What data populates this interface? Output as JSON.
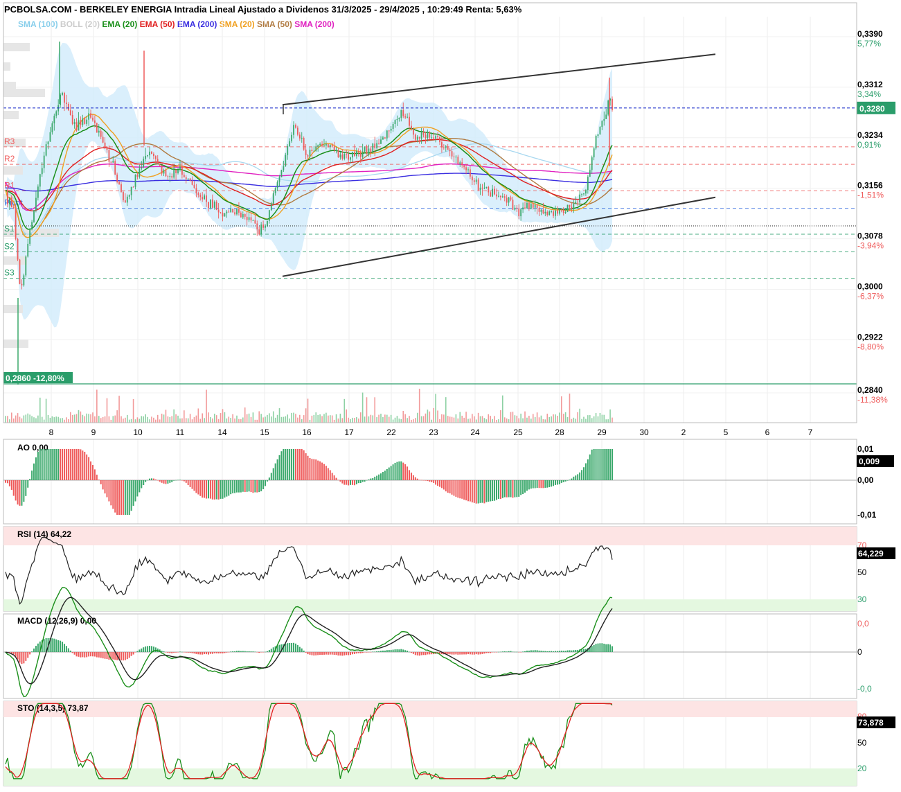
{
  "header": {
    "title": "PCBOLSA.COM - BERKELEY ENERGIA Intradia Lineal Ajustado a Dividenos 31/3/2025 - 29/4/2025 , 10:29:49 Renta: 5,63%"
  },
  "legend": [
    {
      "label": "SMA (100)",
      "color": "#87ceeb"
    },
    {
      "label": "BOLL (20)",
      "color": "#cccccc"
    },
    {
      "label": "EMA (20)",
      "color": "#1a8f1a"
    },
    {
      "label": "EMA (50)",
      "color": "#e02020"
    },
    {
      "label": "EMA (200)",
      "color": "#3a2ee0"
    },
    {
      "label": "SMA (20)",
      "color": "#f0a020"
    },
    {
      "label": "SMA (50)",
      "color": "#b07a40"
    },
    {
      "label": "SMA (200)",
      "color": "#e020c0"
    }
  ],
  "colors": {
    "up": "#3aa86b",
    "down": "#ef5b5b",
    "pivot": "#3a6fe0",
    "support": "#2a9d6a",
    "resistance": "#ef5b5b",
    "boll_fill": "#d3ecfb"
  },
  "chart_data": [
    {
      "type": "line",
      "title": "BERKELEY ENERGIA",
      "x_ticks": [
        "8",
        "9",
        "10",
        "11",
        "14",
        "15",
        "16",
        "17",
        "22",
        "23",
        "24",
        "25",
        "28",
        "29",
        "30",
        "2",
        "5",
        "6",
        "7"
      ],
      "ylim": [
        0.284,
        0.339
      ],
      "y_ticks": [
        {
          "value": "0,3390",
          "pct": "5,77%",
          "pct_color": "#2a9d6a"
        },
        {
          "value": "0,3312",
          "pct": "3,34%",
          "pct_color": "#2a9d6a"
        },
        {
          "value": "0,3234",
          "pct": "0,91%",
          "pct_color": "#2a9d6a"
        },
        {
          "value": "0,3156",
          "pct": "-1,51%",
          "pct_color": "#ef5b5b"
        },
        {
          "value": "0,3078",
          "pct": "-3,94%",
          "pct_color": "#ef5b5b"
        },
        {
          "value": "0,3000",
          "pct": "-6,37%",
          "pct_color": "#ef5b5b"
        },
        {
          "value": "0,2922",
          "pct": "-8,80%",
          "pct_color": "#ef5b5b"
        },
        {
          "value": "0,2840",
          "pct": "-11,38%",
          "pct_color": "#ef5b5b"
        }
      ],
      "last_price": "0,3280",
      "low_marker": "0,2860  -12,80%",
      "levels": [
        {
          "label": "R3",
          "value": 0.322
        },
        {
          "label": "R2",
          "value": 0.3193
        },
        {
          "label": "R1",
          "value": 0.3152
        },
        {
          "label": "Pivot",
          "value": 0.3125
        },
        {
          "label": "S1",
          "value": 0.3085
        },
        {
          "label": "S2",
          "value": 0.3058
        },
        {
          "label": "S3",
          "value": 0.3017
        }
      ],
      "trendlines": [
        {
          "x1": "15",
          "y1": 0.3285,
          "x2": "2",
          "y2": 0.3363
        },
        {
          "x1": "15",
          "y1": 0.302,
          "x2": "2",
          "y2": 0.3142
        }
      ]
    },
    {
      "type": "bar",
      "title": "AO",
      "value_label": "0,00",
      "y_ticks": [
        "0,01",
        "0,00",
        "-0,01"
      ],
      "last_value": "0,009"
    },
    {
      "type": "line",
      "title": "RSI (14)",
      "value_label": "64,22",
      "y_ticks": [
        "70",
        "50",
        "30"
      ],
      "last_value": "64,229"
    },
    {
      "type": "bar",
      "title": "MACD (12,26,9)",
      "value_label": "0,00",
      "y_ticks": [
        "0,0",
        "0",
        "-0,0"
      ]
    },
    {
      "type": "line",
      "title": "STO (14,3,5)",
      "value_label": "73,87",
      "y_ticks": [
        "80",
        "50",
        "20"
      ],
      "last_value": "73,878"
    }
  ]
}
